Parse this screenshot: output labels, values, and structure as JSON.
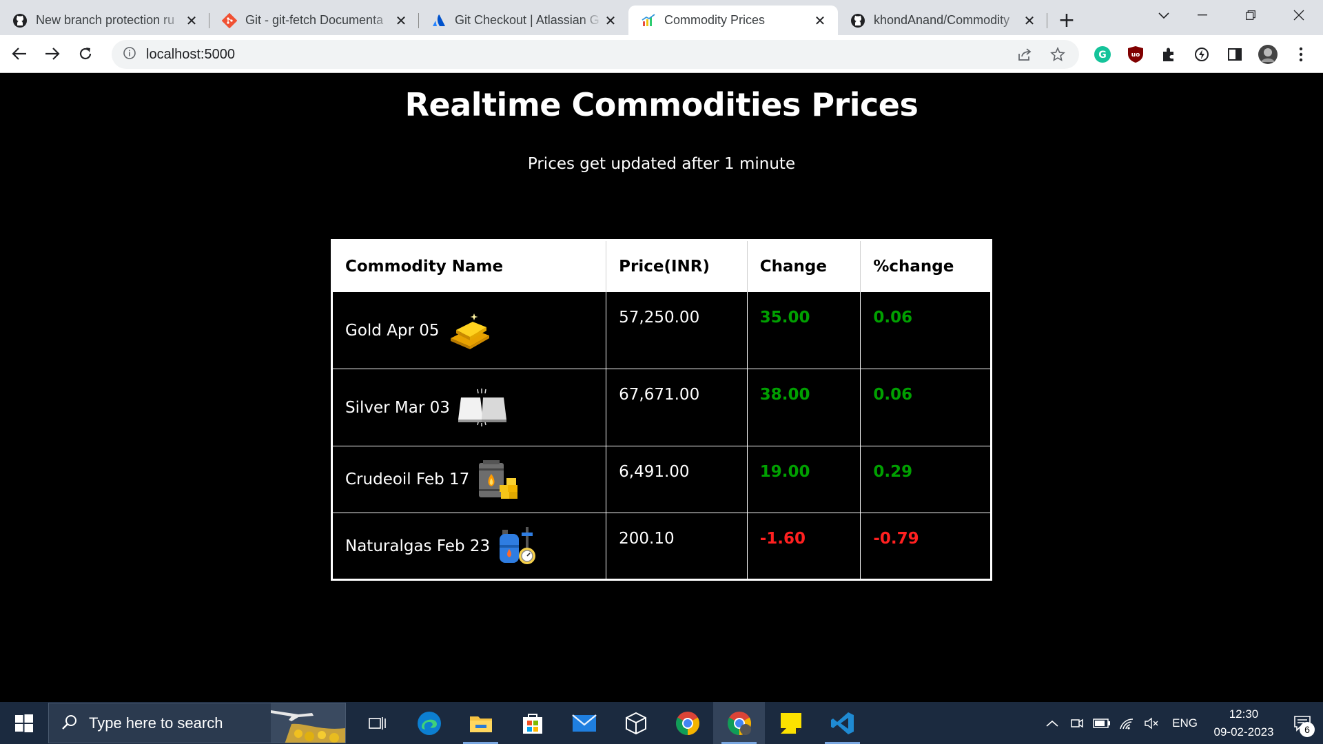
{
  "browser": {
    "tabs": [
      {
        "title": "New branch protection ru",
        "icon": "github-icon",
        "active": false
      },
      {
        "title": "Git - git-fetch Documenta",
        "icon": "git-icon",
        "active": false
      },
      {
        "title": "Git Checkout | Atlassian G",
        "icon": "atlassian-icon",
        "active": false
      },
      {
        "title": "Commodity Prices",
        "icon": "chart-favicon",
        "active": true
      },
      {
        "title": "khondAnand/Commodity",
        "icon": "github-icon",
        "active": false
      }
    ],
    "url": "localhost:5000"
  },
  "page": {
    "title": "Realtime Commodities Prices",
    "subtitle": "Prices get updated after 1 minute",
    "table": {
      "headers": [
        "Commodity Name",
        "Price(INR)",
        "Change",
        "%change"
      ],
      "rows": [
        {
          "name": "Gold Apr 05",
          "icon": "gold-bars-icon",
          "price": "57,250.00",
          "change": "35.00",
          "pct": "0.06",
          "direction": "up"
        },
        {
          "name": "Silver Mar 03",
          "icon": "silver-bars-icon",
          "price": "67,671.00",
          "change": "38.00",
          "pct": "0.06",
          "direction": "up"
        },
        {
          "name": "Crudeoil Feb 17",
          "icon": "oil-barrel-icon",
          "price": "6,491.00",
          "change": "19.00",
          "pct": "0.29",
          "direction": "up"
        },
        {
          "name": "Naturalgas Feb 23",
          "icon": "gas-cylinder-icon",
          "price": "200.10",
          "change": "-1.60",
          "pct": "-0.79",
          "direction": "down"
        }
      ]
    },
    "colors": {
      "positive": "#00a000",
      "negative": "#ff2020"
    }
  },
  "taskbar": {
    "search_placeholder": "Type here to search",
    "language": "ENG",
    "time": "12:30",
    "date": "09-02-2023",
    "notification_count": "6"
  }
}
